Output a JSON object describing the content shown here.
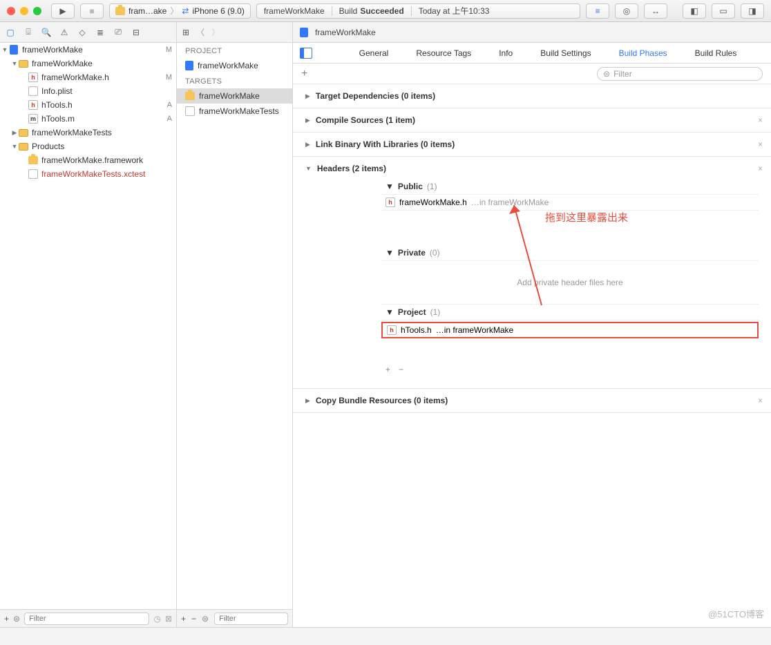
{
  "toolbar": {
    "scheme_app": "fram…ake",
    "scheme_device": "iPhone 6 (9.0)",
    "status_app": "frameWorkMake",
    "status_build": "Build ",
    "status_result": "Succeeded",
    "status_time": "Today at 上午10:33"
  },
  "nav": {
    "root": "frameWorkMake",
    "root_badge": "M",
    "items": [
      {
        "name": "frameWorkMake",
        "type": "folder",
        "indent": 1,
        "open": true
      },
      {
        "name": "frameWorkMake.h",
        "type": "h",
        "indent": 2,
        "badge": "M"
      },
      {
        "name": "Info.plist",
        "type": "plist",
        "indent": 2
      },
      {
        "name": "hTools.h",
        "type": "h",
        "indent": 2,
        "badge": "A"
      },
      {
        "name": "hTools.m",
        "type": "m",
        "indent": 2,
        "badge": "A"
      },
      {
        "name": "frameWorkMakeTests",
        "type": "folder",
        "indent": 1
      },
      {
        "name": "Products",
        "type": "folder",
        "indent": 1,
        "open": true
      },
      {
        "name": "frameWorkMake.framework",
        "type": "fw",
        "indent": 2
      },
      {
        "name": "frameWorkMakeTests.xctest",
        "type": "test",
        "indent": 2,
        "red": true
      }
    ],
    "filter": "Filter"
  },
  "targets": {
    "project_h": "PROJECT",
    "project": "frameWorkMake",
    "targets_h": "TARGETS",
    "t1": "frameWorkMake",
    "t2": "frameWorkMakeTests",
    "filter": "Filter"
  },
  "jump": {
    "file": "frameWorkMake"
  },
  "tabs": [
    "General",
    "Resource Tags",
    "Info",
    "Build Settings",
    "Build Phases",
    "Build Rules"
  ],
  "filter": "Filter",
  "phases": {
    "dep": "Target Dependencies (0 items)",
    "compile": "Compile Sources (1 item)",
    "link": "Link Binary With Libraries (0 items)",
    "headers": "Headers (2 items)",
    "copy": "Copy Bundle Resources (0 items)",
    "public": "Public",
    "public_cnt": "(1)",
    "private": "Private",
    "private_cnt": "(0)",
    "project": "Project",
    "project_cnt": "(1)",
    "f1": "frameWorkMake.h",
    "f1_loc": "…in frameWorkMake",
    "f2": "hTools.h",
    "f2_loc": "…in frameWorkMake",
    "empty_private": "Add private header files here"
  },
  "annotation": "拖到这里暴露出来",
  "watermark": "@51CTO博客"
}
